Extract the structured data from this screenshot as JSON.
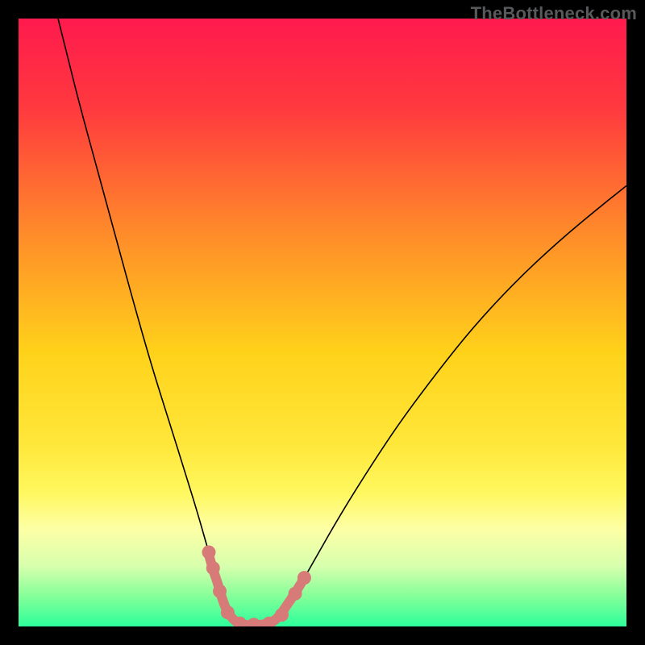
{
  "watermark": "TheBottleneck.com",
  "chart_data": {
    "type": "line",
    "title": "",
    "xlabel": "",
    "ylabel": "",
    "xlim": [
      0,
      100
    ],
    "ylim": [
      0,
      100
    ],
    "background_gradient": {
      "stops": [
        {
          "pos": 0.0,
          "color": "#ff1a4d"
        },
        {
          "pos": 0.15,
          "color": "#ff3a3e"
        },
        {
          "pos": 0.35,
          "color": "#ff8a2a"
        },
        {
          "pos": 0.55,
          "color": "#ffd21a"
        },
        {
          "pos": 0.7,
          "color": "#ffe73a"
        },
        {
          "pos": 0.78,
          "color": "#fff85f"
        },
        {
          "pos": 0.84,
          "color": "#fdffa6"
        },
        {
          "pos": 0.9,
          "color": "#d8ffad"
        },
        {
          "pos": 0.95,
          "color": "#85ff99"
        },
        {
          "pos": 1.0,
          "color": "#2cff9a"
        }
      ]
    },
    "series": [
      {
        "name": "left-curve",
        "stroke": "#000000",
        "stroke_width": 1.6,
        "points": [
          {
            "x": 6.5,
            "y": 100.0
          },
          {
            "x": 8.0,
            "y": 94.0
          },
          {
            "x": 10.0,
            "y": 86.0
          },
          {
            "x": 13.0,
            "y": 75.0
          },
          {
            "x": 16.0,
            "y": 64.0
          },
          {
            "x": 19.0,
            "y": 53.0
          },
          {
            "x": 22.0,
            "y": 42.5
          },
          {
            "x": 25.0,
            "y": 33.0
          },
          {
            "x": 27.5,
            "y": 25.0
          },
          {
            "x": 29.5,
            "y": 18.5
          },
          {
            "x": 31.2,
            "y": 12.5
          },
          {
            "x": 32.8,
            "y": 7.2
          },
          {
            "x": 34.4,
            "y": 2.4
          },
          {
            "x": 35.8,
            "y": 0.6
          }
        ]
      },
      {
        "name": "right-curve",
        "stroke": "#000000",
        "stroke_width": 1.6,
        "points": [
          {
            "x": 41.7,
            "y": 0.6
          },
          {
            "x": 43.5,
            "y": 2.4
          },
          {
            "x": 46.0,
            "y": 6.2
          },
          {
            "x": 49.0,
            "y": 11.5
          },
          {
            "x": 53.0,
            "y": 18.5
          },
          {
            "x": 58.0,
            "y": 26.5
          },
          {
            "x": 63.0,
            "y": 34.0
          },
          {
            "x": 69.0,
            "y": 42.0
          },
          {
            "x": 75.0,
            "y": 49.5
          },
          {
            "x": 82.0,
            "y": 57.0
          },
          {
            "x": 89.0,
            "y": 63.5
          },
          {
            "x": 95.0,
            "y": 68.5
          },
          {
            "x": 100.0,
            "y": 72.5
          }
        ]
      },
      {
        "name": "bottom-marker-path",
        "stroke": "#d67b78",
        "stroke_width": 12,
        "linecap": "round",
        "points": [
          {
            "x": 31.1,
            "y": 12.5
          },
          {
            "x": 32.0,
            "y": 9.3
          },
          {
            "x": 32.8,
            "y": 7.0
          },
          {
            "x": 33.4,
            "y": 4.8
          },
          {
            "x": 34.3,
            "y": 2.4
          },
          {
            "x": 35.8,
            "y": 0.6
          },
          {
            "x": 37.5,
            "y": 0.2
          },
          {
            "x": 39.5,
            "y": 0.2
          },
          {
            "x": 41.7,
            "y": 0.6
          },
          {
            "x": 43.0,
            "y": 1.8
          },
          {
            "x": 44.0,
            "y": 3.3
          },
          {
            "x": 45.3,
            "y": 5.2
          },
          {
            "x": 46.3,
            "y": 6.8
          },
          {
            "x": 47.2,
            "y": 8.3
          }
        ]
      },
      {
        "name": "bottom-marker-dots",
        "type_hint": "scatter",
        "fill": "#d67b78",
        "radius": 8.5,
        "points": [
          {
            "x": 31.3,
            "y": 12.2
          },
          {
            "x": 32.0,
            "y": 9.6
          },
          {
            "x": 33.1,
            "y": 5.8
          },
          {
            "x": 34.4,
            "y": 2.3
          },
          {
            "x": 36.4,
            "y": 0.5
          },
          {
            "x": 38.7,
            "y": 0.3
          },
          {
            "x": 41.2,
            "y": 0.5
          },
          {
            "x": 43.3,
            "y": 1.9
          },
          {
            "x": 45.5,
            "y": 5.4
          },
          {
            "x": 47.0,
            "y": 8.0
          }
        ]
      }
    ]
  }
}
